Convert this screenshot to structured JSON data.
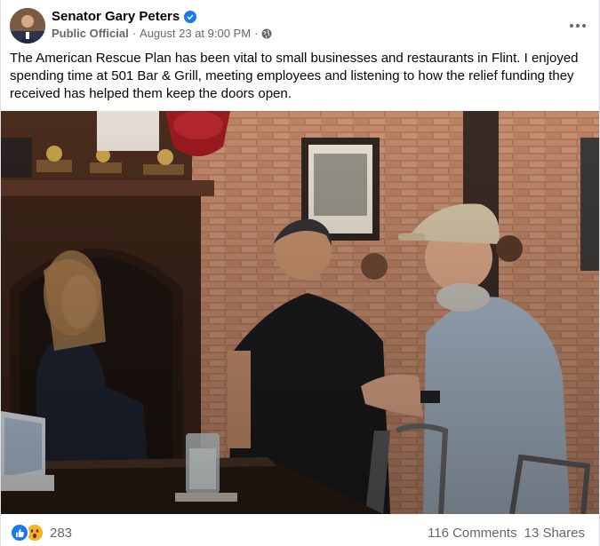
{
  "post": {
    "author": "Senator Gary Peters",
    "role": "Public Official",
    "separator": "·",
    "timestamp": "August 23 at 9:00 PM",
    "separator2": "·",
    "body": "The American Rescue Plan has been vital to small businesses and restaurants in Flint. I enjoyed spending time at 501 Bar & Grill, meeting employees and listening to how the relief funding they received has helped them keep the doors open."
  },
  "icons": {
    "verified": "verified-badge-icon",
    "audience": "globe-icon",
    "more": "more-horizontal-icon",
    "like": "like-reaction-icon",
    "wow": "wow-reaction-icon"
  },
  "footer": {
    "reaction_count": "283",
    "comments": "116 Comments",
    "shares": "13 Shares"
  },
  "colors": {
    "brand_blue": "#1877f2",
    "secondary_text": "#65676b",
    "wow_yellow": "#f7b125"
  }
}
